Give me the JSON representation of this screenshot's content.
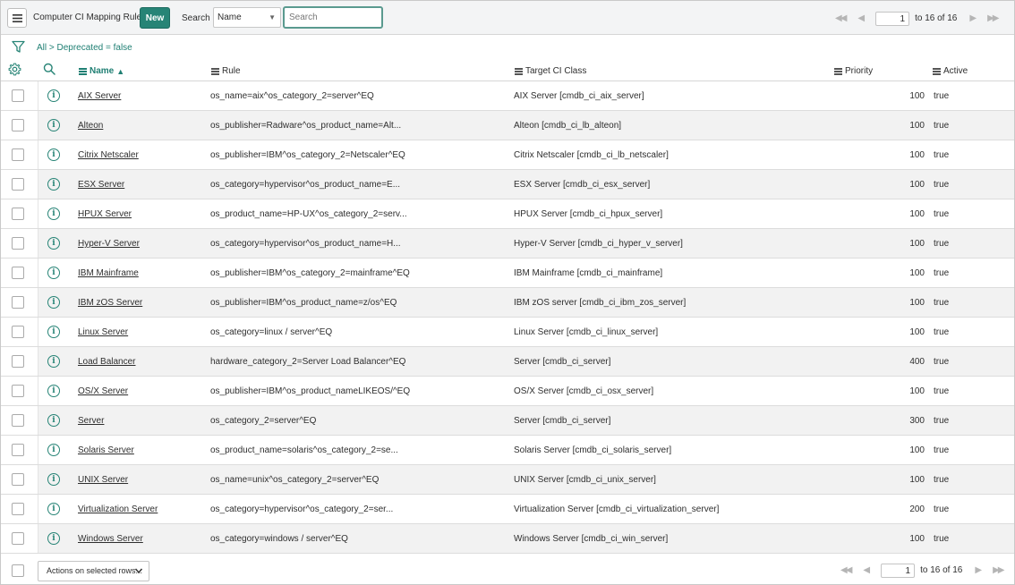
{
  "header": {
    "menu_icon": "hamburger-icon",
    "title": "Computer CI Mapping Rules",
    "new_label": "New",
    "search_label": "Search",
    "search_field_selected": "Name",
    "search_placeholder": "Search"
  },
  "pager": {
    "page": "1",
    "range_text": "to 16 of 16"
  },
  "breadcrumb": {
    "text": "All > Deprecated = false"
  },
  "columns": {
    "name": "Name",
    "rule": "Rule",
    "target": "Target CI Class",
    "priority": "Priority",
    "active": "Active"
  },
  "rows": [
    {
      "name": "AIX Server",
      "rule": "os_name=aix^os_category_2=server^EQ",
      "target": "AIX Server [cmdb_ci_aix_server]",
      "priority": "100",
      "active": "true"
    },
    {
      "name": "Alteon",
      "rule": "os_publisher=Radware^os_product_name=Alt...",
      "target": "Alteon [cmdb_ci_lb_alteon]",
      "priority": "100",
      "active": "true"
    },
    {
      "name": "Citrix Netscaler",
      "rule": "os_publisher=IBM^os_category_2=Netscaler^EQ",
      "target": "Citrix Netscaler [cmdb_ci_lb_netscaler]",
      "priority": "100",
      "active": "true"
    },
    {
      "name": "ESX Server",
      "rule": "os_category=hypervisor^os_product_name=E...",
      "target": "ESX Server [cmdb_ci_esx_server]",
      "priority": "100",
      "active": "true"
    },
    {
      "name": "HPUX Server",
      "rule": "os_product_name=HP-UX^os_category_2=serv...",
      "target": "HPUX Server [cmdb_ci_hpux_server]",
      "priority": "100",
      "active": "true"
    },
    {
      "name": "Hyper-V Server",
      "rule": "os_category=hypervisor^os_product_name=H...",
      "target": "Hyper-V Server [cmdb_ci_hyper_v_server]",
      "priority": "100",
      "active": "true"
    },
    {
      "name": "IBM Mainframe",
      "rule": "os_publisher=IBM^os_category_2=mainframe^EQ",
      "target": "IBM Mainframe [cmdb_ci_mainframe]",
      "priority": "100",
      "active": "true"
    },
    {
      "name": "IBM zOS Server",
      "rule": "os_publisher=IBM^os_product_name=z/os^EQ",
      "target": "IBM zOS server [cmdb_ci_ibm_zos_server]",
      "priority": "100",
      "active": "true"
    },
    {
      "name": "Linux Server",
      "rule": "os_category=linux / server^EQ",
      "target": "Linux Server [cmdb_ci_linux_server]",
      "priority": "100",
      "active": "true"
    },
    {
      "name": "Load Balancer",
      "rule": "hardware_category_2=Server Load Balancer^EQ",
      "target": "Server [cmdb_ci_server]",
      "priority": "400",
      "active": "true"
    },
    {
      "name": "OS/X Server",
      "rule": "os_publisher=IBM^os_product_nameLIKEOS/^EQ",
      "target": "OS/X Server [cmdb_ci_osx_server]",
      "priority": "100",
      "active": "true"
    },
    {
      "name": "Server",
      "rule": "os_category_2=server^EQ",
      "target": "Server [cmdb_ci_server]",
      "priority": "300",
      "active": "true"
    },
    {
      "name": "Solaris Server",
      "rule": "os_product_name=solaris^os_category_2=se...",
      "target": "Solaris Server [cmdb_ci_solaris_server]",
      "priority": "100",
      "active": "true"
    },
    {
      "name": "UNIX Server",
      "rule": "os_name=unix^os_category_2=server^EQ",
      "target": "UNIX Server [cmdb_ci_unix_server]",
      "priority": "100",
      "active": "true"
    },
    {
      "name": "Virtualization Server",
      "rule": "os_category=hypervisor^os_category_2=ser...",
      "target": "Virtualization Server [cmdb_ci_virtualization_server]",
      "priority": "200",
      "active": "true"
    },
    {
      "name": "Windows Server",
      "rule": "os_category=windows / server^EQ",
      "target": "Windows Server [cmdb_ci_win_server]",
      "priority": "100",
      "active": "true"
    }
  ],
  "footer": {
    "actions_label": "Actions on selected rows...",
    "page": "1",
    "range_text": "to 16 of 16"
  },
  "colors": {
    "accent": "#278476",
    "link_teal": "#1f7f73",
    "header_bg": "#f3f4f5",
    "row_alt_bg": "#f2f2f2"
  }
}
